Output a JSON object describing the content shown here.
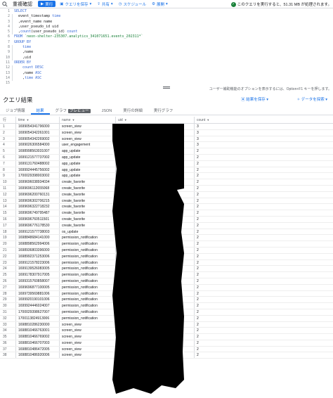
{
  "toolbar": {
    "title": "重複確認",
    "run_label": "実行",
    "save_query_label": "クエリを保存",
    "share_label": "共有",
    "schedule_label": "スケジュール",
    "more_label": "展開",
    "status_text": "このクエリを実行すると、51.31 MB が処理されます。"
  },
  "editor": {
    "line_numbers": [
      "1",
      "2",
      "3",
      "4",
      "5",
      "6",
      "7",
      "8",
      "9",
      "10",
      "11",
      "12",
      "13",
      "14",
      "15"
    ],
    "lines": [
      [
        {
          "t": "SELECT",
          "c": "kw"
        }
      ],
      [
        {
          "t": "  event_timestamp ",
          "c": "id"
        },
        {
          "t": "time",
          "c": "kw"
        }
      ],
      [
        {
          "t": "  ,event_name name",
          "c": "id"
        }
      ],
      [
        {
          "t": "  ,user_pseudo_id uid",
          "c": "id"
        }
      ],
      [
        {
          "t": "  ,",
          "c": "id"
        },
        {
          "t": "count",
          "c": "fn"
        },
        {
          "t": "(user_pseudo_id) ",
          "c": "id"
        },
        {
          "t": "count",
          "c": "kw"
        }
      ],
      [
        {
          "t": "FROM ",
          "c": "kw"
        },
        {
          "t": "`neon-shelter-235307.analytics_341071651.events_202311*`",
          "c": "str"
        }
      ],
      [
        {
          "t": "GROUP BY",
          "c": "kw"
        }
      ],
      [
        {
          "t": "    ",
          "c": "id"
        },
        {
          "t": "time",
          "c": "kw"
        }
      ],
      [
        {
          "t": "    ,name",
          "c": "id"
        }
      ],
      [
        {
          "t": "    ,uid",
          "c": "id"
        }
      ],
      [
        {
          "t": "ORDER BY",
          "c": "kw"
        }
      ],
      [
        {
          "t": "    ",
          "c": "id"
        },
        {
          "t": "count DESC",
          "c": "kw"
        }
      ],
      [
        {
          "t": "    ,name ",
          "c": "id"
        },
        {
          "t": "ASC",
          "c": "kw"
        }
      ],
      [
        {
          "t": "    ,",
          "c": "id"
        },
        {
          "t": "time ASC",
          "c": "kw"
        }
      ],
      [
        {
          "t": "",
          "c": "id"
        }
      ]
    ],
    "hint": "ユーザー補助機能のオプションを表示するには、Option+F1 キーを押します。"
  },
  "results": {
    "title": "クエリ結果",
    "save_results_label": "結果を保存",
    "explore_data_label": "データを探索",
    "tabs": [
      {
        "label": "ジョブ情報"
      },
      {
        "label": "結果"
      },
      {
        "label": "グラフ"
      },
      {
        "label": "JSON"
      },
      {
        "label": "実行の詳細"
      },
      {
        "label": "実行グラフ"
      }
    ],
    "preview_badge": "プレビュー",
    "columns": {
      "row": "行",
      "time": "time",
      "name": "name",
      "uid": "uid",
      "count": "count"
    },
    "rows": [
      {
        "row": "1",
        "time": "1699054341796000",
        "name": "screen_view",
        "count": "3"
      },
      {
        "row": "2",
        "time": "1699054342261001",
        "name": "screen_view",
        "count": "3"
      },
      {
        "row": "3",
        "time": "1699054342269002",
        "name": "screen_view",
        "count": "3"
      },
      {
        "row": "4",
        "time": "1699026306584000",
        "name": "user_engagement",
        "count": "3"
      },
      {
        "row": "5",
        "time": "1698998563031007",
        "name": "app_update",
        "count": "2"
      },
      {
        "row": "6",
        "time": "1699121577737002",
        "name": "app_update",
        "count": "2"
      },
      {
        "row": "7",
        "time": "1699131760488002",
        "name": "app_update",
        "count": "2"
      },
      {
        "row": "8",
        "time": "1699924445756002",
        "name": "app_update",
        "count": "2"
      },
      {
        "row": "9",
        "time": "1700029398003002",
        "name": "app_update",
        "count": "2"
      },
      {
        "row": "10",
        "time": "1699696038934034",
        "name": "create_favorite",
        "count": "2"
      },
      {
        "row": "11",
        "time": "1699696112655068",
        "name": "create_favorite",
        "count": "2"
      },
      {
        "row": "12",
        "time": "1699696200760131",
        "name": "create_favorite",
        "count": "2"
      },
      {
        "row": "13",
        "time": "1699696302706215",
        "name": "create_favorite",
        "count": "2"
      },
      {
        "row": "14",
        "time": "1699696322718232",
        "name": "create_favorite",
        "count": "2"
      },
      {
        "row": "15",
        "time": "1699696749795487",
        "name": "create_favorite",
        "count": "2"
      },
      {
        "row": "16",
        "time": "1699696760511501",
        "name": "create_favorite",
        "count": "2"
      },
      {
        "row": "17",
        "time": "1699696776178530",
        "name": "create_favorite",
        "count": "2"
      },
      {
        "row": "18",
        "time": "1699121577738003",
        "name": "os_update",
        "count": "2"
      },
      {
        "row": "19",
        "time": "1698848684141000",
        "name": "permission_notification",
        "count": "2"
      },
      {
        "row": "20",
        "time": "1698898562994006",
        "name": "permission_notification",
        "count": "2"
      },
      {
        "row": "21",
        "time": "1698936803396000",
        "name": "permission_notification",
        "count": "2"
      },
      {
        "row": "22",
        "time": "1698992371253006",
        "name": "permission_notification",
        "count": "2"
      },
      {
        "row": "23",
        "time": "1699121578223006",
        "name": "permission_notification",
        "count": "2"
      },
      {
        "row": "24",
        "time": "1699139526083005",
        "name": "permission_notification",
        "count": "2"
      },
      {
        "row": "25",
        "time": "1699178307917005",
        "name": "permission_notification",
        "count": "2"
      },
      {
        "row": "26",
        "time": "1699315760858007",
        "name": "permission_notification",
        "count": "2"
      },
      {
        "row": "27",
        "time": "1699696877100005",
        "name": "permission_notification",
        "count": "2"
      },
      {
        "row": "28",
        "time": "1699739569881006",
        "name": "permission_notification",
        "count": "2"
      },
      {
        "row": "29",
        "time": "1699920190101006",
        "name": "permission_notification",
        "count": "2"
      },
      {
        "row": "30",
        "time": "1699924446024007",
        "name": "permission_notification",
        "count": "2"
      },
      {
        "row": "31",
        "time": "1700029398627007",
        "name": "permission_notification",
        "count": "2"
      },
      {
        "row": "32",
        "time": "1700113824913006",
        "name": "permission_notification",
        "count": "2"
      },
      {
        "row": "33",
        "time": "1698810286230000",
        "name": "screen_view",
        "count": "2"
      },
      {
        "row": "34",
        "time": "1698810466763001",
        "name": "screen_view",
        "count": "2"
      },
      {
        "row": "35",
        "time": "1698810466769002",
        "name": "screen_view",
        "count": "2"
      },
      {
        "row": "36",
        "time": "1698810466707003",
        "name": "screen_view",
        "count": "2"
      },
      {
        "row": "37",
        "time": "1698810486472005",
        "name": "screen_view",
        "count": "2"
      },
      {
        "row": "38",
        "time": "1698810486920006",
        "name": "screen_view",
        "count": "2"
      }
    ]
  },
  "colors": {
    "accent": "#1a73e8",
    "success": "#188038",
    "keyword": "#3367d6",
    "string": "#188038"
  },
  "icons": [
    "search-icon",
    "play-icon",
    "save-icon",
    "share-icon",
    "schedule-icon",
    "settings-icon",
    "check-circle-icon"
  ]
}
